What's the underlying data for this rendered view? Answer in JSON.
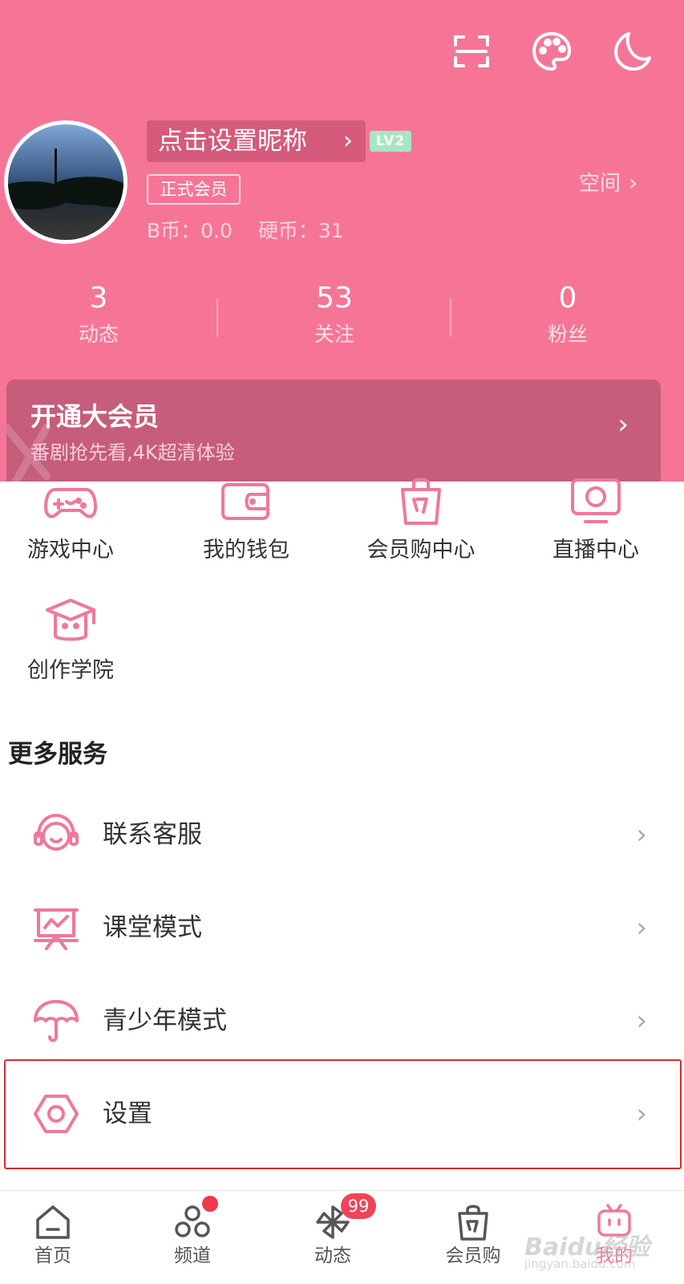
{
  "header": {
    "icons": [
      "scan-icon",
      "palette-icon",
      "moon-icon"
    ],
    "nickname_button": "点击设置昵称",
    "level_badge": "LV2",
    "member_tag": "正式会员",
    "b_coin": "B币：0.0",
    "hard_coin": "硬币：31",
    "space_link": "空间",
    "colors": {
      "background": "#f67597",
      "accent": "#f0789a"
    }
  },
  "stats": [
    {
      "value": "3",
      "label": "动态"
    },
    {
      "value": "53",
      "label": "关注"
    },
    {
      "value": "0",
      "label": "粉丝"
    }
  ],
  "vip": {
    "title": "开通大会员",
    "subtitle": "番剧抢先看,4K超清体验"
  },
  "grid": [
    {
      "label": "游戏中心",
      "icon": "gamepad-icon"
    },
    {
      "label": "我的钱包",
      "icon": "wallet-icon"
    },
    {
      "label": "会员购中心",
      "icon": "shopping-bag-icon"
    },
    {
      "label": "直播中心",
      "icon": "tv-icon"
    },
    {
      "label": "创作学院",
      "icon": "graduation-cap-icon"
    }
  ],
  "more_services": {
    "title": "更多服务",
    "items": [
      {
        "label": "联系客服",
        "icon": "headset-icon"
      },
      {
        "label": "课堂模式",
        "icon": "presentation-board-icon"
      },
      {
        "label": "青少年模式",
        "icon": "umbrella-icon"
      },
      {
        "label": "设置",
        "icon": "settings-hexagon-icon"
      }
    ]
  },
  "bottom_nav": [
    {
      "label": "首页",
      "icon": "home-icon"
    },
    {
      "label": "频道",
      "icon": "channels-icon",
      "dot": true
    },
    {
      "label": "动态",
      "icon": "pinwheel-icon",
      "badge": "99"
    },
    {
      "label": "会员购",
      "icon": "shopping-bag-icon"
    },
    {
      "label": "我的",
      "icon": "tv-face-icon",
      "active": true
    }
  ],
  "watermark": {
    "text": "Baidu经验",
    "sub": "jingyan.baidu.com"
  }
}
